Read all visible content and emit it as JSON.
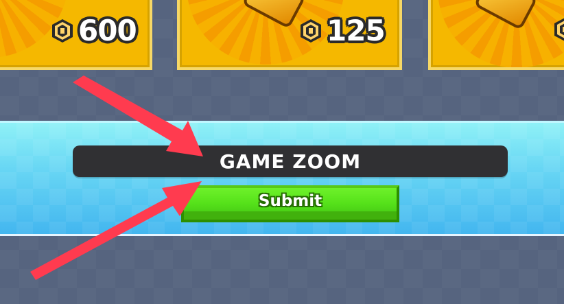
{
  "shop": {
    "cards": [
      {
        "price": "600",
        "currency_icon": "robux-icon"
      },
      {
        "price": "125",
        "currency_icon": "robux-icon"
      },
      {
        "price": "",
        "currency_icon": "robux-icon"
      }
    ]
  },
  "setting": {
    "label": "GAME ZOOM",
    "submit_label": "Submit"
  },
  "colors": {
    "background": "#56647f",
    "card": "#f5b800",
    "banner": "#69d7f4",
    "label_bar": "#303033",
    "submit_button": "#55e11a",
    "arrow": "#ff3b4f"
  }
}
